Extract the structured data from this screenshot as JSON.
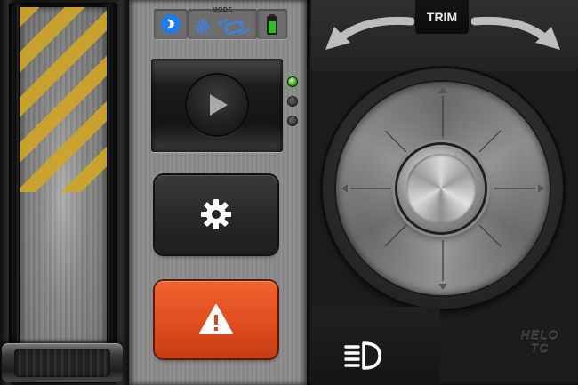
{
  "status": {
    "mode_label": "MODE",
    "bluetooth_icon": "bluetooth-icon",
    "mode_icon": "gear-mode-icon",
    "battery_icon": "battery-icon",
    "battery_color": "#2fbf1e"
  },
  "controls": {
    "play_icon": "play-icon",
    "settings_icon": "gear-icon",
    "alert_icon": "warning-icon",
    "alert_color": "#e8552a",
    "leds": [
      true,
      false,
      false
    ]
  },
  "steering": {
    "trim_label": "TRIM",
    "lights_icon": "headlight-icon"
  },
  "brand": {
    "line1": "HELO",
    "line2": "TC"
  }
}
